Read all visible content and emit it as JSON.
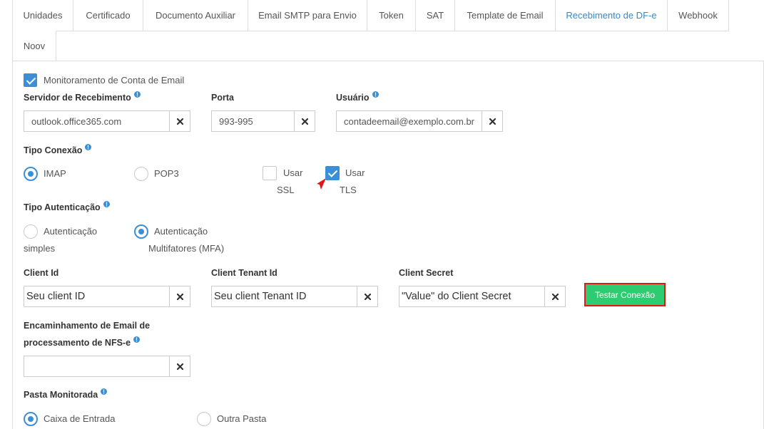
{
  "tabs": [
    {
      "label": "Unidades",
      "active": false
    },
    {
      "label": "Certificado",
      "active": false
    },
    {
      "label": "Documento Auxiliar",
      "active": false
    },
    {
      "label": "Email SMTP para Envio",
      "active": false
    },
    {
      "label": "Token",
      "active": false
    },
    {
      "label": "SAT",
      "active": false
    },
    {
      "label": "Template de Email",
      "active": false
    },
    {
      "label": "Recebimento de DF-e",
      "active": true
    },
    {
      "label": "Webhook",
      "active": false
    },
    {
      "label": "Noov",
      "active": false
    }
  ],
  "monitoramento": {
    "label": "Monitoramento de Conta de Email",
    "checked": true
  },
  "servidor": {
    "label": "Servidor de Recebimento",
    "value": "outlook.office365.com"
  },
  "porta": {
    "label": "Porta",
    "value": "993-995"
  },
  "usuario": {
    "label": "Usuário",
    "value": "contadeemail@exemplo.com.br"
  },
  "tipo_conexao": {
    "label": "Tipo Conexão",
    "options": [
      {
        "label": "IMAP",
        "selected": true
      },
      {
        "label": "POP3",
        "selected": false
      }
    ],
    "ssl": {
      "label": "Usar SSL",
      "checked": false
    },
    "tls": {
      "label": "Usar TLS",
      "checked": true
    }
  },
  "tipo_autenticacao": {
    "label": "Tipo Autenticação",
    "options": [
      {
        "label": "Autenticação simples",
        "selected": false
      },
      {
        "label": "Autenticação Multifatores (MFA)",
        "selected": true
      }
    ]
  },
  "client_id": {
    "label": "Client Id",
    "value": "Seu client ID"
  },
  "client_tenant_id": {
    "label": "Client Tenant Id",
    "value": "Seu client Tenant ID"
  },
  "client_secret": {
    "label": "Client Secret",
    "value": "\"Value\" do Client Secret"
  },
  "testar_conexao": {
    "label": "Testar Conexão"
  },
  "encaminhamento": {
    "label": "Encaminhamento de Email de processamento de NFS-e",
    "value": ""
  },
  "pasta_monitorada": {
    "label": "Pasta Monitorada",
    "options": [
      {
        "label": "Caixa de Entrada",
        "selected": true
      },
      {
        "label": "Outra Pasta",
        "selected": false
      }
    ]
  },
  "icons": {
    "clear": "clear-icon",
    "info": "info-icon",
    "check": "check-icon",
    "annotation": "red-arrow-annotation"
  },
  "colors": {
    "accent": "#3a8fd6",
    "active_tab_text": "#3a87c8",
    "button": "#2ecc71",
    "annotation": "#e0161b"
  }
}
